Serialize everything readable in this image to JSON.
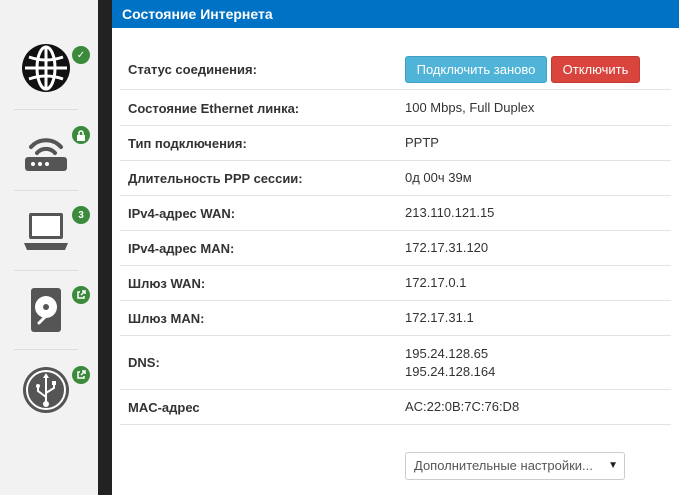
{
  "sidebar": {
    "items": [
      {
        "name": "internet",
        "icon": "globe-icon",
        "badge_icon": "check-icon"
      },
      {
        "name": "wifi",
        "icon": "wifi-router-icon",
        "badge_icon": "lock-icon"
      },
      {
        "name": "clients",
        "icon": "laptop-icon",
        "badge": "3"
      },
      {
        "name": "storage",
        "icon": "disk-icon",
        "badge_icon": "external-link-icon"
      },
      {
        "name": "usb",
        "icon": "usb-icon",
        "badge_icon": "external-link-icon"
      }
    ]
  },
  "panel": {
    "title": "Состояние Интернета"
  },
  "status": {
    "label": "Статус соединения:",
    "reconnect_label": "Подключить заново",
    "disconnect_label": "Отключить"
  },
  "rows": [
    {
      "label": "Состояние Ethernet линка:",
      "value": "100 Mbps, Full Duplex"
    },
    {
      "label": "Тип подключения:",
      "value": "PPTP"
    },
    {
      "label": "Длительность PPP сессии:",
      "value": "0д 00ч 39м"
    },
    {
      "label": "IPv4-адрес WAN:",
      "value": "213.110.121.15"
    },
    {
      "label": "IPv4-адрес MAN:",
      "value": "172.17.31.120"
    },
    {
      "label": "Шлюз WAN:",
      "value": "172.17.0.1"
    },
    {
      "label": "Шлюз MAN:",
      "value": "172.17.31.1"
    }
  ],
  "dns": {
    "label": "DNS:",
    "values": [
      "195.24.128.65",
      "195.24.128.164"
    ]
  },
  "mac": {
    "label": "MAC-адрес",
    "value": "AC:22:0B:7C:76:D8"
  },
  "more_settings": {
    "selected": "Дополнительные настройки..."
  },
  "colors": {
    "header": "#0072c6",
    "reconnect": "#4fb4d8",
    "disconnect": "#d9453d",
    "badge": "#3c8a3c"
  }
}
